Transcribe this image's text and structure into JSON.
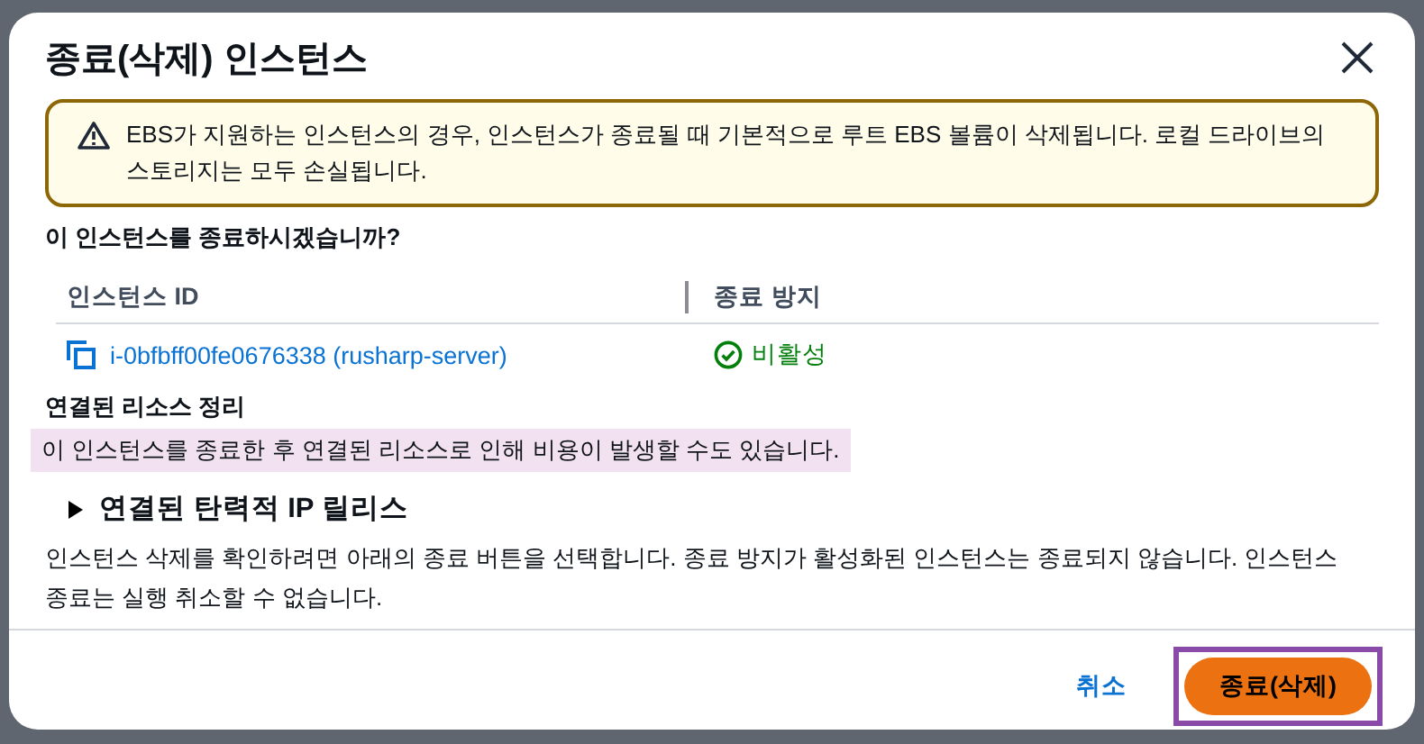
{
  "dialog": {
    "title": "종료(삭제) 인스턴스",
    "alert": {
      "kind": "warning",
      "text": "EBS가 지원하는 인스턴스의 경우, 인스턴스가 종료될 때 기본적으로 루트 EBS 볼륨이 삭제됩니다. 로컬 드라이브의 스토리지는 모두 손실됩니다."
    },
    "question": "이 인스턴스를 종료하시겠습니까?",
    "table": {
      "columns": [
        "인스턴스 ID",
        "종료 방지"
      ],
      "rows": [
        {
          "instance": "i-0bfbff00fe0676338 (rusharp-server)",
          "protection": "비활성",
          "protection_on": false
        }
      ]
    },
    "cleanup": {
      "heading": "연결된 리소스 정리",
      "note": "이 인스턴스를 종료한 후 연결된 리소스로 인해 비용이 발생할 수도 있습니다.",
      "highlighted": true
    },
    "expander": {
      "label": "연결된 탄력적 IP 릴리스",
      "expanded": false
    },
    "description": "인스턴스 삭제를 확인하려면 아래의 종료 버튼을 선택합니다. 종료 방지가 활성화된 인스턴스는 종료되지 않습니다. 인스턴스 종료는 실행 취소할 수 없습니다.",
    "buttons": [
      {
        "label": "취소",
        "kind": "link",
        "outlined": false
      },
      {
        "label": "종료(삭제)",
        "kind": "primary",
        "outlined": true
      }
    ]
  }
}
